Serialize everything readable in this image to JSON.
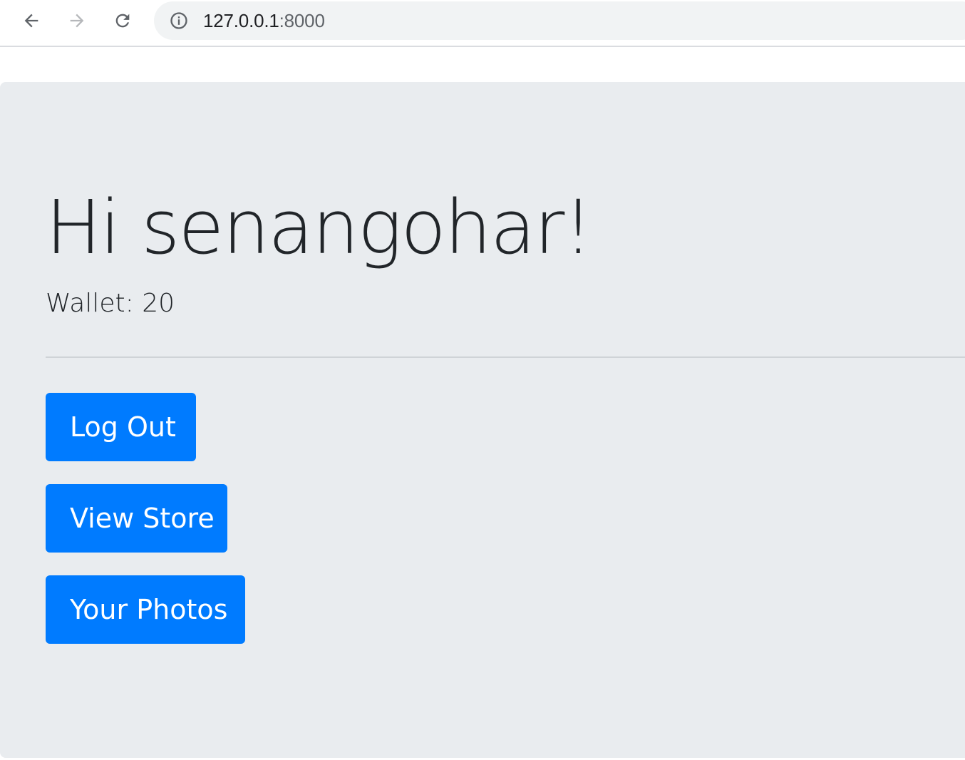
{
  "browser": {
    "url_host": "127.0.0.1",
    "url_port": ":8000",
    "icons": {
      "back": "arrow-left-icon",
      "forward": "arrow-right-icon",
      "reload": "reload-icon",
      "site_info": "info-circle-icon"
    }
  },
  "page": {
    "greeting": "Hi senangohar!",
    "wallet_text": "Wallet: 20",
    "buttons": {
      "logout": "Log Out",
      "view_store": "View Store",
      "your_photos": "Your Photos"
    },
    "colors": {
      "jumbotron_bg": "#e9ecef",
      "primary": "#007bff",
      "text": "#212529"
    }
  }
}
